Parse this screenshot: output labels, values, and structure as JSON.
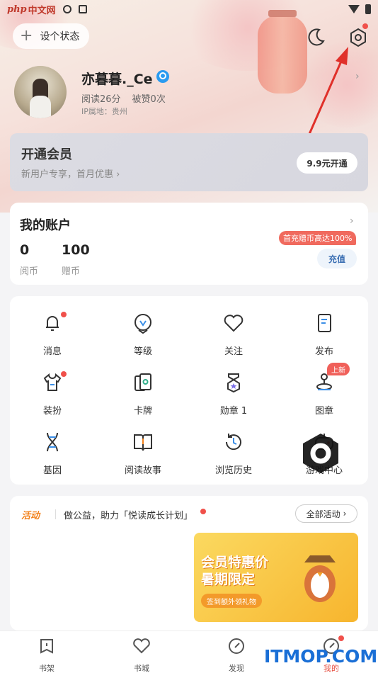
{
  "status_bar": {
    "site_logo_php": "php",
    "site_logo_cn": "中文网",
    "time": ""
  },
  "header": {
    "status_button": "设个状态"
  },
  "profile": {
    "username": "亦暮暮._Ce",
    "read_stat": "阅读26分",
    "like_stat": "被赞0次",
    "ip_location": "IP属地：贵州"
  },
  "membership": {
    "title": "开通会员",
    "subtitle": "新用户专享，首月优惠 ›",
    "button": "9.9元开通"
  },
  "account": {
    "title": "我的账户",
    "read_coin_value": "0",
    "read_coin_label": "阅币",
    "gift_coin_value": "100",
    "gift_coin_label": "赠币",
    "promo": "首充赠币高达100%",
    "recharge": "充值"
  },
  "grid": {
    "items": [
      {
        "label": "消息",
        "icon": "bell-icon",
        "badge": true
      },
      {
        "label": "等级",
        "icon": "level-icon"
      },
      {
        "label": "关注",
        "icon": "heart-icon"
      },
      {
        "label": "发布",
        "icon": "publish-icon"
      },
      {
        "label": "装扮",
        "icon": "shirt-icon",
        "badge": true
      },
      {
        "label": "卡牌",
        "icon": "cards-icon"
      },
      {
        "label": "勋章 1",
        "icon": "medal-icon"
      },
      {
        "label": "图章",
        "icon": "stamp-icon",
        "tag": "上新"
      },
      {
        "label": "基因",
        "icon": "dna-icon"
      },
      {
        "label": "阅读故事",
        "icon": "book-icon"
      },
      {
        "label": "浏览历史",
        "icon": "history-icon"
      },
      {
        "label": "游戏中心",
        "icon": "gamepad-icon"
      }
    ],
    "new_tag": "上新"
  },
  "activity": {
    "tag": "活动",
    "text": "做公益，助力「悦读成长计划」",
    "all_button": "全部活动",
    "banner_title": "会员特惠价 暑期限定",
    "banner_sub": "签到额外领礼物"
  },
  "bottom_nav": {
    "items": [
      {
        "label": "书架",
        "icon": "bookshelf-icon"
      },
      {
        "label": "书城",
        "icon": "bookstore-icon"
      },
      {
        "label": "发现",
        "icon": "discover-icon"
      },
      {
        "label": "我的",
        "icon": "profile-icon",
        "active": true
      }
    ]
  },
  "watermark": "ITMOP.COM",
  "colors": {
    "accent": "#e54a3c",
    "activity_orange": "#f2811b",
    "recharge_blue": "#3b6fb3",
    "watermark_blue": "#1a6fd6"
  }
}
